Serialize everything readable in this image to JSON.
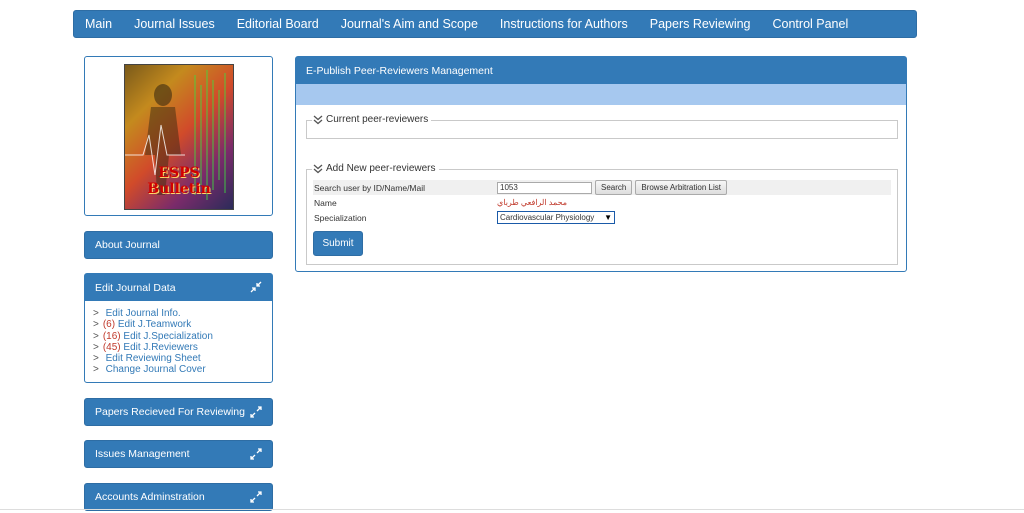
{
  "nav": {
    "items": [
      "Main",
      "Journal Issues",
      "Editorial Board",
      "Journal's Aim and Scope",
      "Instructions for Authors",
      "Papers Reviewing",
      "Control Panel"
    ]
  },
  "cover": {
    "title": "ESPS Bulletin"
  },
  "sidebar": {
    "about": "About Journal",
    "edit_panel": {
      "title": "Edit Journal Data",
      "links": [
        {
          "count": "",
          "label": "Edit Journal Info."
        },
        {
          "count": "(6)",
          "label": "Edit J.Teamwork"
        },
        {
          "count": "(16)",
          "label": "Edit J.Specialization"
        },
        {
          "count": "(45)",
          "label": "Edit J.Reviewers"
        },
        {
          "count": "",
          "label": "Edit Reviewing Sheet"
        },
        {
          "count": "",
          "label": "Change Journal Cover"
        }
      ]
    },
    "papers": "Papers Recieved For Reviewing",
    "issues": "Issues Management",
    "accounts": "Accounts Adminstration"
  },
  "main": {
    "title": "E-Publish Peer-Reviewers Management",
    "current_legend": "Current peer-reviewers",
    "add_legend": "Add New peer-reviewers",
    "search_label": "Search user by ID/Name/Mail",
    "search_value": "1053",
    "search_button": "Search",
    "browse_button": "Browse Arbitration List",
    "name_label": "Name",
    "name_value": "محمد الرافعي طرباي",
    "spec_label": "Specialization",
    "spec_value": "Cardiovascular Physiology",
    "submit": "Submit"
  },
  "colors": {
    "primary": "#337ab7",
    "band": "#a6c8ef",
    "accent_red": "#c0392b"
  }
}
